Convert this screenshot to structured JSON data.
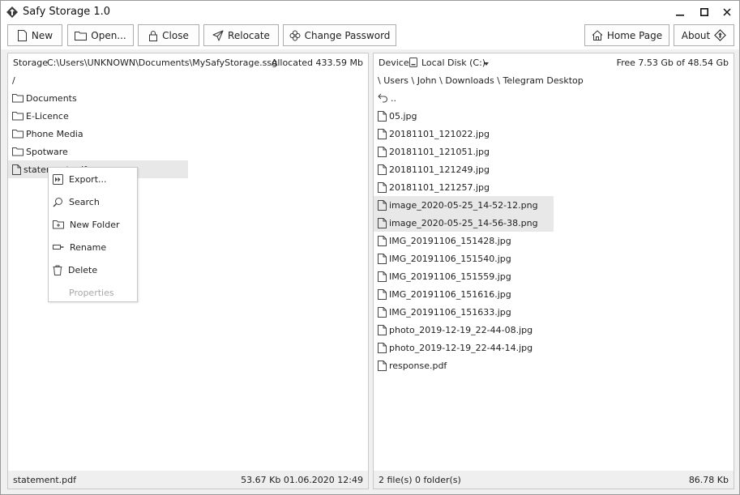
{
  "window": {
    "title": "Safy Storage 1.0"
  },
  "toolbar": {
    "new_label": "New",
    "open_label": "Open...",
    "close_label": "Close",
    "relocate_label": "Relocate",
    "change_password_label": "Change Password",
    "home_page_label": "Home Page",
    "about_label": "About"
  },
  "storage_panel": {
    "label": "Storage",
    "path": "C:\\Users\\UNKNOWN\\Documents\\MySafyStorage.ssg",
    "allocated": "Allocated 433.59 Mb",
    "current_path": "/",
    "items": [
      {
        "name": "Documents",
        "type": "folder"
      },
      {
        "name": "E-Licence",
        "type": "folder"
      },
      {
        "name": "Phone Media",
        "type": "folder"
      },
      {
        "name": "Spotware",
        "type": "folder"
      },
      {
        "name": "statement.pdf",
        "type": "file"
      }
    ],
    "status": {
      "selected_name": "statement.pdf",
      "size_date": "53.67 Kb  01.06.2020 12:49"
    }
  },
  "context_menu": {
    "items": [
      {
        "label": "Export...",
        "icon": "export-icon",
        "enabled": true
      },
      {
        "label": "Search",
        "icon": "search-icon",
        "enabled": true
      },
      {
        "label": "New Folder",
        "icon": "new-folder-icon",
        "enabled": true
      },
      {
        "label": "Rename",
        "icon": "rename-icon",
        "enabled": true
      },
      {
        "label": "Delete",
        "icon": "trash-icon",
        "enabled": true
      },
      {
        "label": "Properties",
        "icon": "",
        "enabled": false
      }
    ]
  },
  "device_panel": {
    "label": "Device",
    "drive": "Local Disk (C:)",
    "free": "Free 7.53 Gb of 48.54 Gb",
    "path_segments": [
      "Users",
      "John",
      "Downloads",
      "Telegram Desktop"
    ],
    "up_label": "..",
    "files": [
      {
        "name": "05.jpg",
        "selected": false
      },
      {
        "name": "20181101_121022.jpg",
        "selected": false
      },
      {
        "name": "20181101_121051.jpg",
        "selected": false
      },
      {
        "name": "20181101_121249.jpg",
        "selected": false
      },
      {
        "name": "20181101_121257.jpg",
        "selected": false
      },
      {
        "name": "image_2020-05-25_14-52-12.png",
        "selected": true
      },
      {
        "name": "image_2020-05-25_14-56-38.png",
        "selected": true
      },
      {
        "name": "IMG_20191106_151428.jpg",
        "selected": false
      },
      {
        "name": "IMG_20191106_151540.jpg",
        "selected": false
      },
      {
        "name": "IMG_20191106_151559.jpg",
        "selected": false
      },
      {
        "name": "IMG_20191106_151616.jpg",
        "selected": false
      },
      {
        "name": "IMG_20191106_151633.jpg",
        "selected": false
      },
      {
        "name": "photo_2019-12-19_22-44-08.jpg",
        "selected": false
      },
      {
        "name": "photo_2019-12-19_22-44-14.jpg",
        "selected": false
      },
      {
        "name": "response.pdf",
        "selected": false
      }
    ],
    "status": {
      "counts": "2 file(s)  0 folder(s)",
      "size": "86.78 Kb"
    }
  },
  "colors": {
    "selection": "#e8e8e8",
    "status_bg": "#efefef",
    "window_bg": "#f0f0f0",
    "border": "#c8c8c8"
  }
}
